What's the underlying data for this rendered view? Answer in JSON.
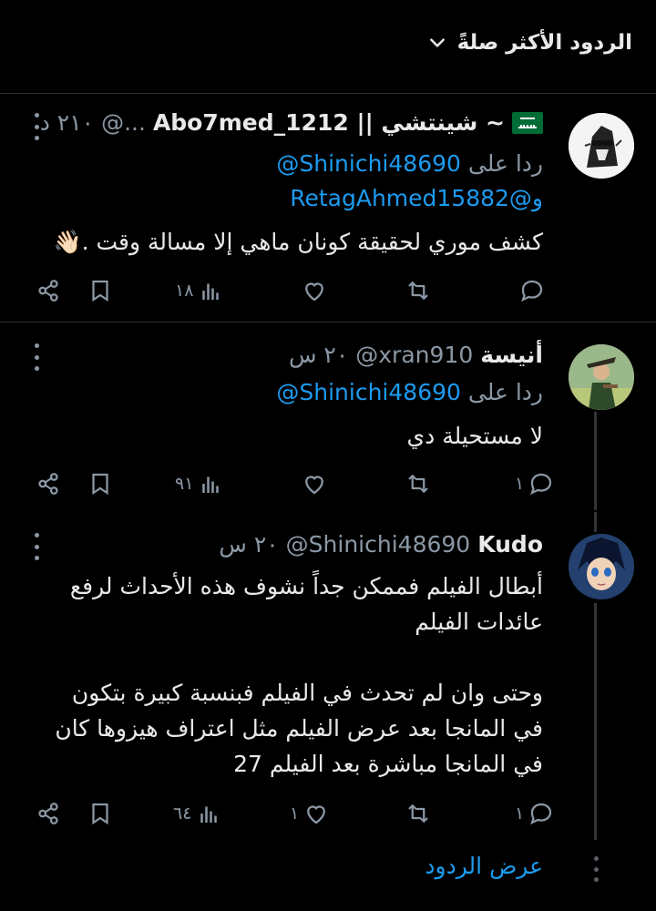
{
  "header": {
    "sort_label": "الردود الأكثر صلةً"
  },
  "tweets": [
    {
      "name": "~ شينتشي || Abo7med_1212",
      "handle": "@...",
      "time": "٢١٠ د",
      "reply_prefix": "ردا على",
      "reply_mentions": [
        "@Shinichi48690",
        "و@RetagAhmed15882"
      ],
      "text": "كشف موري لحقيقة كونان ماهي إلا مسالة وقت .👋🏻",
      "counts": {
        "reply": "",
        "retweet": "",
        "like": "",
        "views": "١٨"
      }
    },
    {
      "name": "أنيسة",
      "handle": "@xran910",
      "time": "٢٠ س",
      "reply_prefix": "ردا على",
      "reply_mentions": [
        "@Shinichi48690"
      ],
      "text": "لا مستحيلة دي",
      "counts": {
        "reply": "١",
        "retweet": "",
        "like": "",
        "views": "٩١"
      }
    },
    {
      "name": "Kudo",
      "handle": "@Shinichi48690",
      "time": "٢٠ س",
      "text_lines": [
        "أبطال الفيلم فممكن جداً نشوف هذه الأحداث لرفع",
        "عائدات الفيلم",
        "",
        "وحتى وان لم تحدث في الفيلم فبنسبة كبيرة بتكون",
        "في المانجا بعد عرض الفيلم مثل اعتراف هيزوها كان",
        "في المانجا مباشرة بعد الفيلم 27"
      ],
      "counts": {
        "reply": "١",
        "retweet": "",
        "like": "١",
        "views": "٦٤"
      }
    }
  ],
  "show_replies": "عرض الردود",
  "colors": {
    "accent": "#1d9bf0",
    "muted": "#8b98a5",
    "border": "#2f3336",
    "background": "#000000"
  }
}
